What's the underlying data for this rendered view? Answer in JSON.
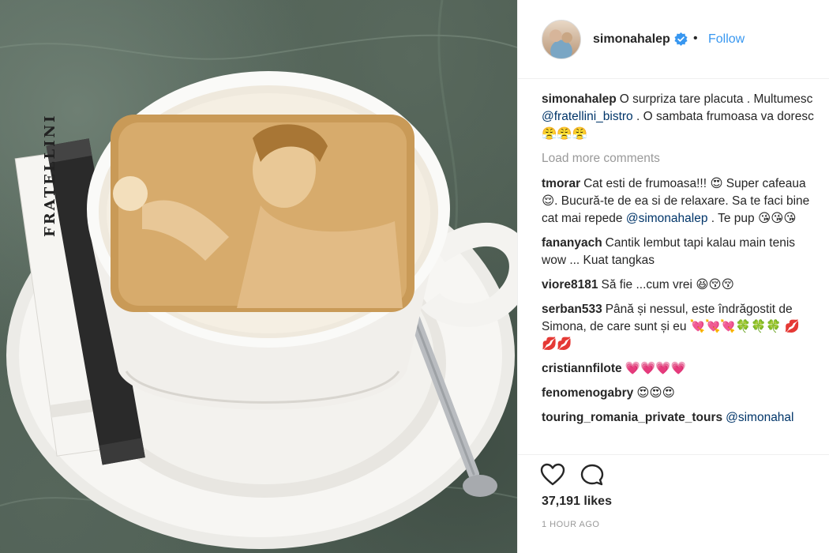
{
  "post": {
    "username": "simonahalep",
    "follow_label": "Follow",
    "dot": "•",
    "image_brand": "FRATELLINI"
  },
  "caption": {
    "user": "simonahalep",
    "text_before": "O surpriza tare placuta . Multumesc ",
    "mention": "@fratellini_bistro",
    "text_after": " . O sambata frumoasa va doresc 😤😤😤"
  },
  "load_more": "Load more comments",
  "comments": [
    {
      "user": "tmorar",
      "parts": [
        "Cat esti de frumoasa!!! 😍 Super cafeaua 😌. Bucură-te de ea si de relaxare. Sa te faci bine cat mai repede "
      ],
      "mention": "@simonahalep",
      "tail": " . Te pup 😘😘😘"
    },
    {
      "user": "fananyach",
      "parts": [
        "Cantik lembut tapi kalau main tenis wow ... Kuat tangkas"
      ],
      "mention": "",
      "tail": ""
    },
    {
      "user": "viore8181",
      "parts": [
        "Să fie ...cum vrei 😆😚😚"
      ],
      "mention": "",
      "tail": ""
    },
    {
      "user": "serban533",
      "parts": [
        "Până și nessul, este îndrăgostit de Simona, de care sunt și eu 💘💘💘🍀🍀🍀 💋💋💋"
      ],
      "mention": "",
      "tail": ""
    },
    {
      "user": "cristiannfilote",
      "parts": [
        "💗💗💗💗"
      ],
      "mention": "",
      "tail": ""
    },
    {
      "user": "fenomenogabry",
      "parts": [
        "😍😍😍"
      ],
      "mention": "",
      "tail": ""
    },
    {
      "user": "touring_romania_private_tours",
      "parts": [
        ""
      ],
      "mention": "@simonahal",
      "tail": ""
    }
  ],
  "likes": "37,191 likes",
  "time": "1 HOUR AGO",
  "colors": {
    "link": "#3897f0",
    "mention": "#003569",
    "muted": "#999999",
    "verified": "#3897f0"
  }
}
